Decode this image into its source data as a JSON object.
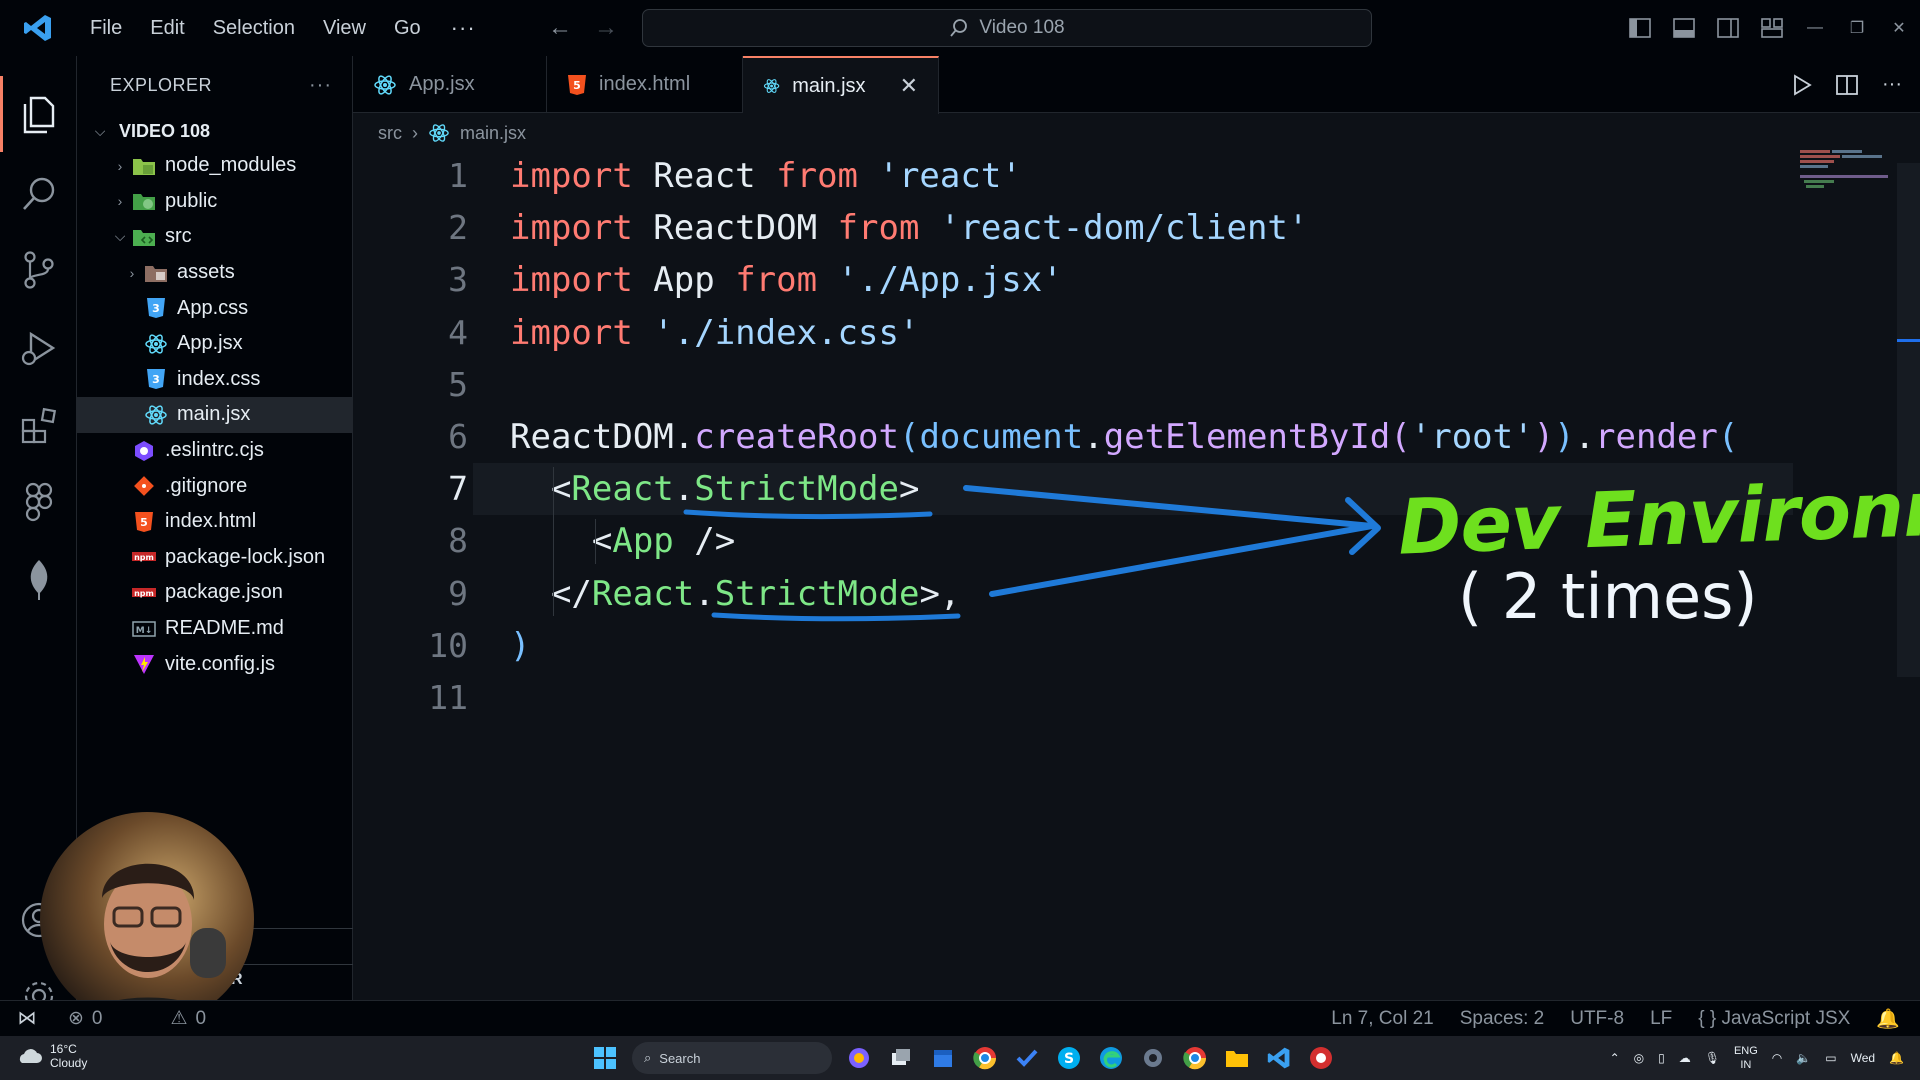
{
  "titlebar": {
    "menu": [
      "File",
      "Edit",
      "Selection",
      "View",
      "Go"
    ],
    "more": "···",
    "search_text": "Video 108"
  },
  "sidebar": {
    "title": "EXPLORER",
    "more": "···",
    "project": "VIDEO 108",
    "files": [
      {
        "name": "node_modules"
      },
      {
        "name": "public"
      },
      {
        "name": "src"
      },
      {
        "name": "assets"
      },
      {
        "name": "App.css"
      },
      {
        "name": "App.jsx"
      },
      {
        "name": "index.css"
      },
      {
        "name": "main.jsx"
      },
      {
        "name": ".eslintrc.cjs"
      },
      {
        "name": ".gitignore"
      },
      {
        "name": "index.html"
      },
      {
        "name": "package-lock.json"
      },
      {
        "name": "package.json"
      },
      {
        "name": "README.md"
      },
      {
        "name": "vite.config.js"
      }
    ],
    "outline_label": "R"
  },
  "tabs": [
    {
      "label": "App.jsx"
    },
    {
      "label": "index.html"
    },
    {
      "label": "main.jsx"
    }
  ],
  "breadcrumb": {
    "folder": "src",
    "file": "main.jsx"
  },
  "editor": {
    "line_numbers": [
      "1",
      "2",
      "3",
      "4",
      "5",
      "6",
      "7",
      "8",
      "9",
      "10",
      "11"
    ],
    "lines": [
      [
        [
          "kw",
          "import"
        ],
        [
          "pl",
          " React "
        ],
        [
          "kw",
          "from"
        ],
        [
          "str",
          " 'react'"
        ]
      ],
      [
        [
          "kw",
          "import"
        ],
        [
          "pl",
          " ReactDOM "
        ],
        [
          "kw",
          "from"
        ],
        [
          "str",
          " 'react-dom/client'"
        ]
      ],
      [
        [
          "kw",
          "import"
        ],
        [
          "pl",
          " App "
        ],
        [
          "kw",
          "from"
        ],
        [
          "str",
          " './App.jsx'"
        ]
      ],
      [
        [
          "kw",
          "import"
        ],
        [
          "str",
          " './index.css'"
        ]
      ],
      [],
      [
        [
          "pl",
          "ReactDOM"
        ],
        [
          "pl",
          "."
        ],
        [
          "fn",
          "createRoot"
        ],
        [
          "ob",
          "("
        ],
        [
          "ob",
          "document"
        ],
        [
          "pl",
          "."
        ],
        [
          "fn",
          "getElementById"
        ],
        [
          "fn",
          "("
        ],
        [
          "str",
          "'root'"
        ],
        [
          "fn",
          ")"
        ],
        [
          "ob",
          ")"
        ],
        [
          "pl",
          "."
        ],
        [
          "fn",
          "render"
        ],
        [
          "ob",
          "("
        ]
      ],
      [
        [
          "pl",
          "  <"
        ],
        [
          "tag",
          "React"
        ],
        [
          "pl",
          "."
        ],
        [
          "tag",
          "StrictMode"
        ],
        [
          "pl",
          ">"
        ]
      ],
      [
        [
          "pl",
          "    <"
        ],
        [
          "tag",
          "App"
        ],
        [
          "pl",
          " />"
        ]
      ],
      [
        [
          "pl",
          "  </"
        ],
        [
          "tag",
          "React"
        ],
        [
          "pl",
          "."
        ],
        [
          "tag",
          "StrictMode"
        ],
        [
          "pl",
          ">,"
        ]
      ],
      [
        [
          "ob",
          ")"
        ]
      ],
      []
    ]
  },
  "annotation": {
    "title": "Dev Environment",
    "subtitle": "( 2 times)"
  },
  "statusbar": {
    "errors": "0",
    "warnings": "0",
    "position": "Ln 7, Col 21",
    "spaces": "Spaces: 2",
    "encoding": "UTF-8",
    "eol": "LF",
    "language": "JavaScript JSX"
  },
  "taskbar": {
    "temp": "16°C",
    "weather": "Cloudy",
    "search": "Search",
    "lang1": "ENG",
    "lang2": "IN",
    "day": "Wed"
  },
  "colors": {
    "keyword": "#ff7b72",
    "string": "#a5d6ff",
    "function": "#d2a8ff",
    "tag": "#7ee787",
    "accent": "#f78166",
    "annotation": "#6ee01e",
    "arrow": "#1f7ad8"
  }
}
